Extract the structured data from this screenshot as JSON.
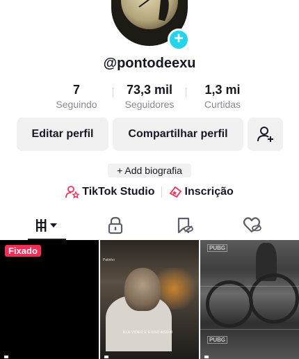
{
  "profile": {
    "username": "@pontodeexu",
    "add_icon": "plus-icon"
  },
  "stats": [
    {
      "value": "7",
      "label": "Seguindo"
    },
    {
      "value": "73,3 mil",
      "label": "Seguidores"
    },
    {
      "value": "1,3 mi",
      "label": "Curtidas"
    }
  ],
  "actions": {
    "edit_label": "Editar perfil",
    "share_label": "Compartilhar perfil",
    "add_friend_icon": "add-user-icon"
  },
  "bio": {
    "add_label": "+ Add biografia"
  },
  "links": {
    "studio_label": "TikTok Studio",
    "subscription_label": "Inscrição"
  },
  "tabs": [
    {
      "name": "videos",
      "icon": "grid-columns-icon",
      "active": true
    },
    {
      "name": "private",
      "icon": "lock-icon",
      "active": false
    },
    {
      "name": "favorites",
      "icon": "bookmark-icon",
      "active": false
    },
    {
      "name": "liked",
      "icon": "heart-icon",
      "active": false
    }
  ],
  "videos": [
    {
      "pinned_label": "Fixado"
    },
    {
      "caption": "ELA VIDEO E EISSO ASSIM",
      "watermark": "Patinho"
    },
    {
      "watermark": "PUBG"
    }
  ],
  "colors": {
    "accent": "#fe2c55",
    "badge": "#20d5ec",
    "button_bg": "#f1f1f2",
    "text": "#161823",
    "muted": "#8a8b91"
  }
}
